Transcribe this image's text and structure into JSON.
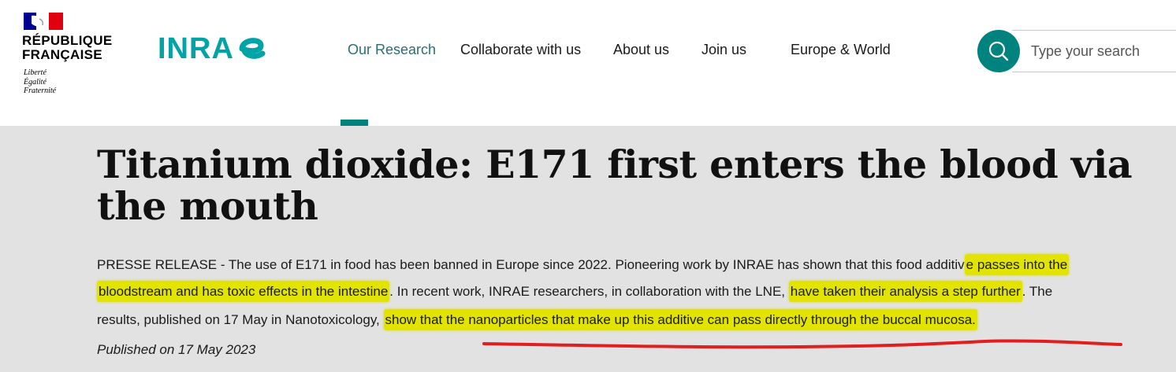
{
  "header": {
    "republique": {
      "name_lines": [
        "RÉPUBLIQUE",
        "FRANÇAISE"
      ],
      "motto": [
        "Liberté",
        "Égalité",
        "Fraternité"
      ]
    },
    "brand": {
      "name": "INRA",
      "color": "#00a3a6"
    },
    "nav": [
      {
        "label": "Our Research",
        "active": true
      },
      {
        "label": "Collaborate with us",
        "active": false
      },
      {
        "label": "About us",
        "active": false
      },
      {
        "label": "Join us",
        "active": false
      },
      {
        "label": "Europe & World",
        "active": false
      }
    ],
    "search": {
      "placeholder": "Type your search",
      "icon": "search-icon"
    }
  },
  "article": {
    "title": "Titanium dioxide: E171 first enters the blood via the mouth",
    "lead": {
      "line1_a": "PRESSE RELEASE - The use of E171 in food has been banned in Europe since 2022. Pioneering work by INRAE has shown that this food additiv",
      "line1_b": "e passes into the",
      "line2_a": "bloodstream and has toxic effects in the intestine",
      "line2_b": ". In recent work, INRAE researchers, in collaboration with the LNE, ",
      "line2_c": "have taken their analysis a step further",
      "line2_d": ". The",
      "line3_a": "results, published on 17 May in Nanotoxicology, ",
      "line3_b": "show that the nanoparticles that make up this additive can pass directly through the buccal mucosa."
    },
    "published": "Published on 17 May 2023"
  },
  "colors": {
    "accent": "#00827f",
    "highlight": "#e2e400",
    "annotation": "#e02020",
    "band": "#e2e2e2"
  }
}
